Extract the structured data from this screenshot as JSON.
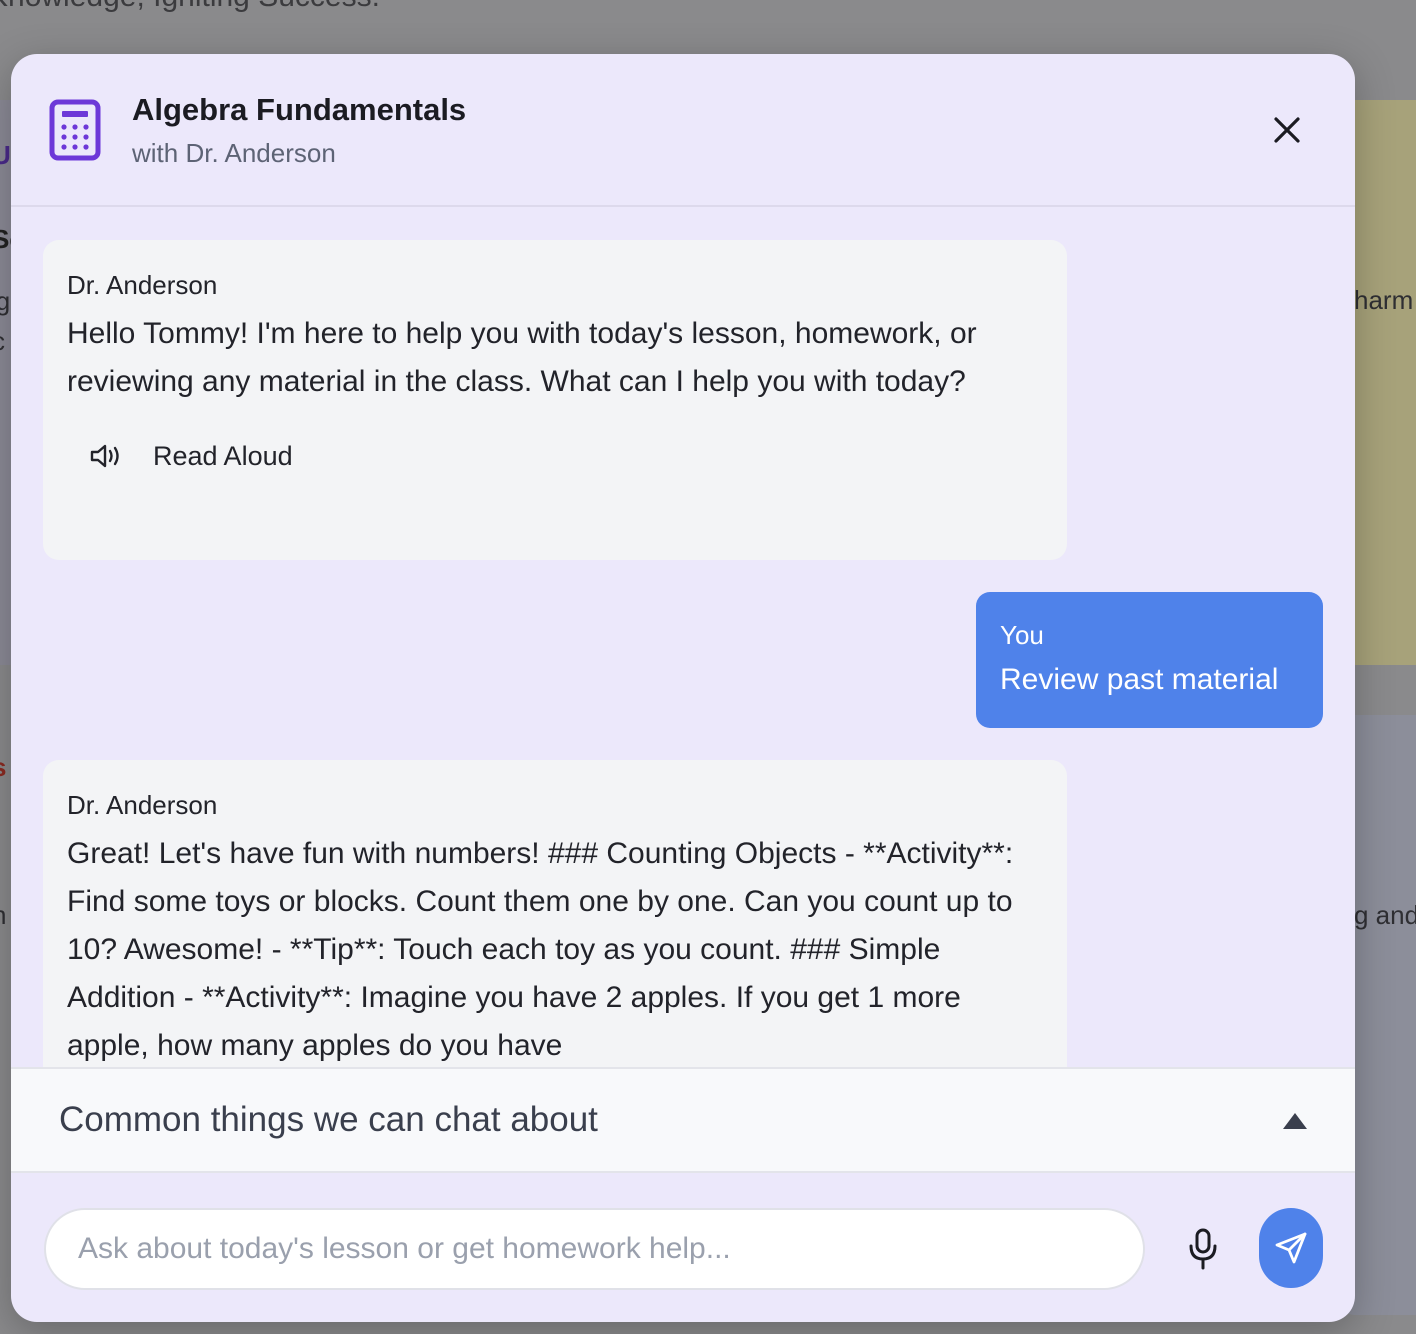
{
  "background": {
    "tagline": "Knowledge, Igniting Success.",
    "fragments": [
      "U",
      "Se",
      "lg",
      "c",
      "s",
      "n",
      "harm",
      "g and"
    ]
  },
  "modal": {
    "title": "Algebra Fundamentals",
    "subtitle": "with Dr. Anderson",
    "class_icon": "calculator-icon",
    "close_icon": "close-icon",
    "accent_color": "#6d38d8",
    "user_bubble_color": "#4f82ea"
  },
  "messages": [
    {
      "sender": "Dr. Anderson",
      "text": "Hello Tommy! I'm here to help you with today's lesson, homework, or reviewing any material in the class. What can I help you with today?",
      "read_aloud_label": "Read Aloud"
    },
    {
      "sender": "You",
      "text": "Review past material"
    },
    {
      "sender": "Dr. Anderson",
      "text": "Great! Let's have fun with numbers! ### Counting Objects - **Activity**: Find some toys or blocks. Count them one by one. Can you count up to 10? Awesome! - **Tip**: Touch each toy as you count. ### Simple Addition - **Activity**: Imagine you have 2 apples. If you get 1 more apple, how many apples do you have"
    }
  ],
  "suggestions": {
    "title": "Common things we can chat about",
    "caret_icon": "caret-up-icon"
  },
  "input": {
    "placeholder": "Ask about today's lesson or get homework help...",
    "value": "",
    "mic_icon": "microphone-icon",
    "send_icon": "send-icon"
  }
}
